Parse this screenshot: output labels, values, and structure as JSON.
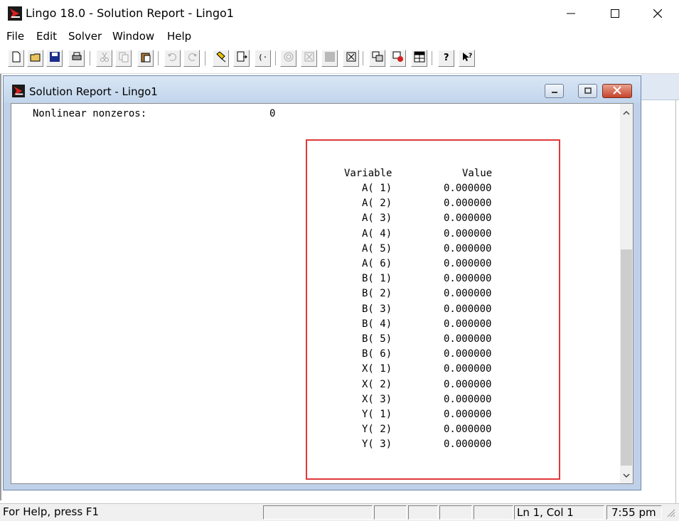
{
  "app": {
    "title": "Lingo 18.0 - Solution Report - Lingo1"
  },
  "menu": [
    "File",
    "Edit",
    "Solver",
    "Window",
    "Help"
  ],
  "toolbar": {
    "icons": [
      "new-file-icon",
      "open-folder-icon",
      "save-icon",
      "print-icon",
      "cut-icon",
      "copy-icon",
      "paste-icon",
      "undo-icon",
      "redo-icon",
      "find-icon",
      "go-to-line-icon",
      "match-parenthesis-icon",
      "solve-icon",
      "compile-icon",
      "stop-icon",
      "close-all-icon",
      "send-to-back-icon",
      "close-window-icon",
      "tile-icon",
      "help-icon",
      "help-pointer-icon"
    ]
  },
  "child": {
    "title": "Solution Report - Lingo1"
  },
  "report": {
    "nonlinear_label": "Nonlinear nonzeros:",
    "nonlinear_value": "0",
    "header_variable": "Variable",
    "header_value": "Value",
    "rows": [
      {
        "name": "A( 1)",
        "value": "0.000000"
      },
      {
        "name": "A( 2)",
        "value": "0.000000"
      },
      {
        "name": "A( 3)",
        "value": "0.000000"
      },
      {
        "name": "A( 4)",
        "value": "0.000000"
      },
      {
        "name": "A( 5)",
        "value": "0.000000"
      },
      {
        "name": "A( 6)",
        "value": "0.000000"
      },
      {
        "name": "B( 1)",
        "value": "0.000000"
      },
      {
        "name": "B( 2)",
        "value": "0.000000"
      },
      {
        "name": "B( 3)",
        "value": "0.000000"
      },
      {
        "name": "B( 4)",
        "value": "0.000000"
      },
      {
        "name": "B( 5)",
        "value": "0.000000"
      },
      {
        "name": "B( 6)",
        "value": "0.000000"
      },
      {
        "name": "X( 1)",
        "value": "0.000000"
      },
      {
        "name": "X( 2)",
        "value": "0.000000"
      },
      {
        "name": "X( 3)",
        "value": "0.000000"
      },
      {
        "name": "Y( 1)",
        "value": "0.000000"
      },
      {
        "name": "Y( 2)",
        "value": "0.000000"
      },
      {
        "name": "Y( 3)",
        "value": "0.000000"
      }
    ]
  },
  "status": {
    "help": "For Help, press F1",
    "position": "Ln 1, Col 1",
    "time": "7:55 pm"
  },
  "colors": {
    "highlight_border": "#e0393a",
    "child_title": "#c2d5ec"
  }
}
